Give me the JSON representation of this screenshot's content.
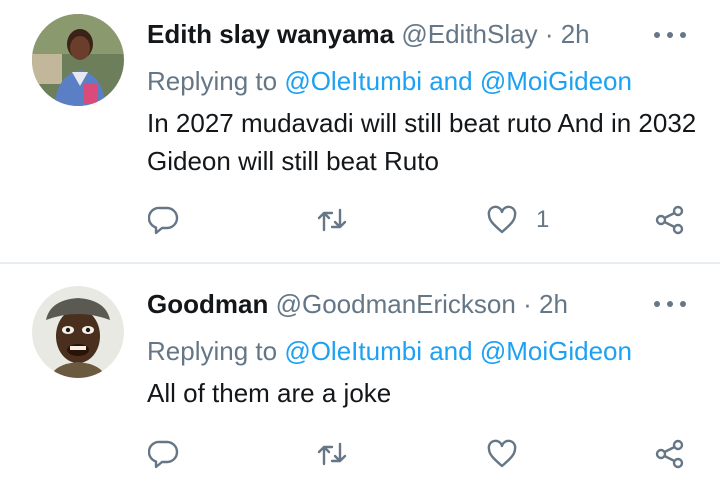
{
  "tweets": [
    {
      "display_name": "Edith slay wanyama",
      "handle": "@EdithSlay",
      "separator": "·",
      "time": "2h",
      "replying_prefix": "Replying to",
      "replying_mention1": "@OleItumbi",
      "replying_joiner": "and",
      "replying_mention2": "@MoiGideon",
      "text": "In 2027 mudavadi will still beat ruto  And in 2032 Gideon will still beat Ruto",
      "like_count": "1"
    },
    {
      "display_name": "Goodman",
      "handle": "@GoodmanErickson",
      "separator": "·",
      "time": "2h",
      "replying_prefix": "Replying to",
      "replying_mention1": "@OleItumbi",
      "replying_joiner": "and",
      "replying_mention2": "@MoiGideon",
      "text": "All of them are a joke",
      "like_count": ""
    }
  ],
  "icons": {
    "reply": "reply-icon",
    "retweet": "retweet-icon",
    "like": "heart-icon",
    "share": "share-icon",
    "more": "more-icon"
  },
  "colors": {
    "text_primary": "#14171a",
    "text_secondary": "#657786",
    "mention": "#1da1f2",
    "divider": "#e6ecf0"
  }
}
